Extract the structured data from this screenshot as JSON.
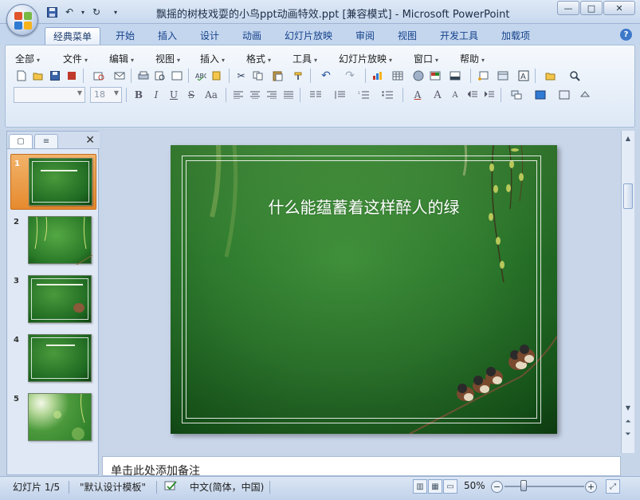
{
  "window": {
    "title": "飘摇的树枝戏耍的小鸟ppt动画特效.ppt [兼容模式] - Microsoft PowerPoint",
    "minimize": "—",
    "maximize": "□",
    "close": "✕"
  },
  "quick_access": {
    "save": "💾",
    "undo": "↶",
    "undo_arrow": "▾",
    "redo": "↻",
    "more": "▾"
  },
  "tabs": [
    {
      "label": "经典菜单"
    },
    {
      "label": "开始"
    },
    {
      "label": "插入"
    },
    {
      "label": "设计"
    },
    {
      "label": "动画"
    },
    {
      "label": "幻灯片放映"
    },
    {
      "label": "审阅"
    },
    {
      "label": "视图"
    },
    {
      "label": "开发工具"
    },
    {
      "label": "加载项"
    }
  ],
  "help_icon": "?",
  "menus": [
    {
      "label": "全部"
    },
    {
      "label": "文件"
    },
    {
      "label": "编辑"
    },
    {
      "label": "视图"
    },
    {
      "label": "插入"
    },
    {
      "label": "格式"
    },
    {
      "label": "工具"
    },
    {
      "label": "幻灯片放映"
    },
    {
      "label": "窗口"
    },
    {
      "label": "帮助"
    }
  ],
  "menu_arrow": "▾",
  "toolbar": {
    "font_name": "",
    "font_size": "18",
    "bold": "B",
    "italic": "I",
    "underline": "U",
    "strike": "S",
    "case": "Aa",
    "font_color": "A",
    "grow": "A",
    "shrink": "A"
  },
  "left_pane": {
    "tab_slides": "▢",
    "tab_outline": "≡",
    "close": "✕",
    "slides": [
      {
        "num": "1",
        "selected": true
      },
      {
        "num": "2",
        "selected": false
      },
      {
        "num": "3",
        "selected": false
      },
      {
        "num": "4",
        "selected": false
      },
      {
        "num": "5",
        "selected": false
      }
    ]
  },
  "slide": {
    "title": "什么能蕴蓄着这样醉人的绿"
  },
  "notes_placeholder": "单击此处添加备注",
  "status_bar": {
    "slide_info": "幻灯片 1/5",
    "template": "\"默认设计模板\"",
    "language": "中文(简体，中国)",
    "zoom": "50%",
    "zoom_level_percent": 50
  },
  "colors": {
    "slide_green": "#2e7a2e",
    "selected_thumb": "#e68a2e",
    "ribbon_bg": "#dde8f6"
  }
}
